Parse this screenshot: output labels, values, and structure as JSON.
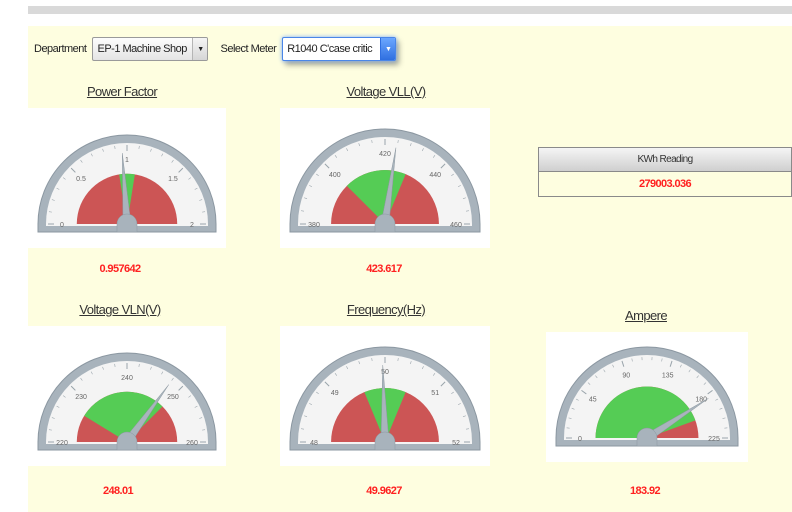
{
  "filters": {
    "department_label": "Department",
    "department_value": "EP-1 Machine Shop",
    "meter_label": "Select Meter",
    "meter_value": "R1040 C'case critic"
  },
  "colors": {
    "background": "#fefee0",
    "value_text": "#ff2020",
    "gauge_red": "#cc5555",
    "gauge_green": "#55cc55",
    "gauge_frame": "#a8b3bc"
  },
  "gauges": {
    "power_factor": {
      "title": "Power Factor",
      "value": "0.957642",
      "reading": 0.957642,
      "min": 0,
      "max": 2,
      "green": [
        0.9,
        1.1
      ],
      "tick_labels": [
        "0",
        "0.5",
        "1",
        "1.5",
        "2"
      ]
    },
    "voltage_vll": {
      "title": "Voltage VLL(V)",
      "value": "423.617",
      "reading": 423.617,
      "min": 380,
      "max": 460,
      "green": [
        400,
        430
      ],
      "tick_labels": [
        "380",
        "400",
        "420",
        "440",
        "460"
      ]
    },
    "voltage_vln": {
      "title": "Voltage VLN(V)",
      "value": "248.01",
      "reading": 248.01,
      "min": 220,
      "max": 260,
      "green": [
        227,
        250
      ],
      "tick_labels": [
        "220",
        "230",
        "240",
        "250",
        "260"
      ]
    },
    "frequency": {
      "title": "Frequency(Hz)",
      "value": "49.9627",
      "reading": 49.9627,
      "min": 48,
      "max": 52,
      "green": [
        49.5,
        50.5
      ],
      "tick_labels": [
        "48",
        "49",
        "50",
        "51",
        "52"
      ]
    },
    "ampere": {
      "title": "Ampere",
      "value": "183.92",
      "reading": 183.92,
      "min": 0,
      "max": 225,
      "green": [
        0,
        200
      ],
      "tick_labels": [
        "0",
        "45",
        "90",
        "135",
        "180",
        "225"
      ]
    }
  },
  "kwh": {
    "header": "KWh Reading",
    "value": "279003.036"
  }
}
